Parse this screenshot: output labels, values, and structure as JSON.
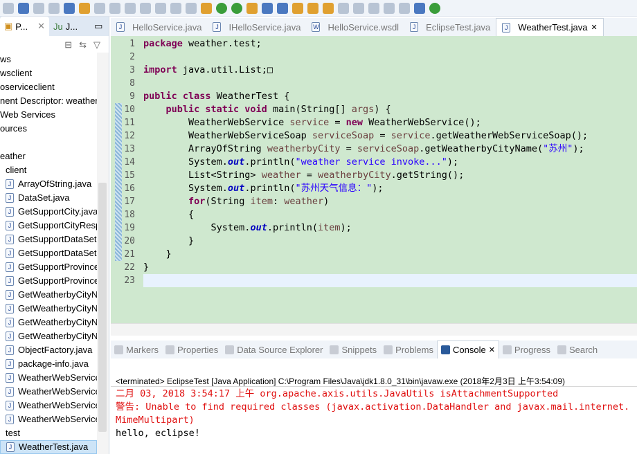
{
  "left_panel": {
    "tabs": [
      {
        "label": "P...",
        "icon": "package-explorer-icon"
      },
      {
        "label": "J...",
        "icon": "junit-icon"
      }
    ],
    "tree": [
      {
        "label": "ws",
        "icon": false,
        "indent": 0
      },
      {
        "label": "wsclient",
        "icon": false,
        "indent": 0
      },
      {
        "label": "oserviceclient",
        "icon": false,
        "indent": 0
      },
      {
        "label": "nent Descriptor: weather",
        "icon": false,
        "indent": 0
      },
      {
        "label": "Web Services",
        "icon": false,
        "indent": 0
      },
      {
        "label": "ources",
        "icon": false,
        "indent": 0
      },
      {
        "label": "",
        "icon": false,
        "indent": 0
      },
      {
        "label": "eather",
        "icon": false,
        "indent": 0
      },
      {
        "label": "client",
        "icon": false,
        "indent": 8
      },
      {
        "label": "ArrayOfString.java",
        "icon": true
      },
      {
        "label": "DataSet.java",
        "icon": true
      },
      {
        "label": "GetSupportCity.java",
        "icon": true
      },
      {
        "label": "GetSupportCityResponse",
        "icon": true
      },
      {
        "label": "GetSupportDataSet",
        "icon": true
      },
      {
        "label": "GetSupportDataSet",
        "icon": true
      },
      {
        "label": "GetSupportProvince",
        "icon": true
      },
      {
        "label": "GetSupportProvince",
        "icon": true
      },
      {
        "label": "GetWeatherbyCityN",
        "icon": true
      },
      {
        "label": "GetWeatherbyCityN",
        "icon": true
      },
      {
        "label": "GetWeatherbyCityN",
        "icon": true
      },
      {
        "label": "GetWeatherbyCityN",
        "icon": true
      },
      {
        "label": "ObjectFactory.java",
        "icon": true
      },
      {
        "label": "package-info.java",
        "icon": true
      },
      {
        "label": "WeatherWebService",
        "icon": true
      },
      {
        "label": "WeatherWebService",
        "icon": true
      },
      {
        "label": "WeatherWebService",
        "icon": true
      },
      {
        "label": "WeatherWebService",
        "icon": true
      },
      {
        "label": "test",
        "icon": false,
        "indent": 8
      },
      {
        "label": "WeatherTest.java",
        "icon": true,
        "selected": true
      }
    ]
  },
  "editor": {
    "tabs": [
      {
        "label": "HelloService.java"
      },
      {
        "label": "IHelloService.java"
      },
      {
        "label": "HelloService.wsdl"
      },
      {
        "label": "EclipseTest.java"
      },
      {
        "label": "WeatherTest.java",
        "active": true
      }
    ],
    "lines": [
      {
        "n": "1",
        "seg": [
          [
            "package",
            "kw"
          ],
          [
            " weather.test;",
            ""
          ]
        ]
      },
      {
        "n": "2",
        "seg": []
      },
      {
        "n": "3",
        "seg": [
          [
            "import",
            "kw"
          ],
          [
            " java.util.List;□",
            ""
          ]
        ]
      },
      {
        "n": "8",
        "seg": []
      },
      {
        "n": "9",
        "seg": [
          [
            "public class",
            "kw"
          ],
          [
            " WeatherTest {",
            ""
          ]
        ]
      },
      {
        "n": "10",
        "seg": [
          [
            "    ",
            ""
          ],
          [
            "public static void",
            "kw"
          ],
          [
            " main(String[] ",
            ""
          ],
          [
            "args",
            "var"
          ],
          [
            ") {",
            ""
          ]
        ]
      },
      {
        "n": "11",
        "seg": [
          [
            "        WeatherWebService ",
            ""
          ],
          [
            "service",
            "var"
          ],
          [
            " = ",
            ""
          ],
          [
            "new",
            "kw"
          ],
          [
            " WeatherWebService();",
            ""
          ]
        ]
      },
      {
        "n": "12",
        "seg": [
          [
            "        WeatherWebServiceSoap ",
            ""
          ],
          [
            "serviceSoap",
            "var"
          ],
          [
            " = ",
            ""
          ],
          [
            "service",
            "var"
          ],
          [
            ".getWeatherWebServiceSoap();",
            ""
          ]
        ]
      },
      {
        "n": "13",
        "seg": [
          [
            "        ArrayOfString ",
            ""
          ],
          [
            "weatherbyCity",
            "var"
          ],
          [
            " = ",
            ""
          ],
          [
            "serviceSoap",
            "var"
          ],
          [
            ".getWeatherbyCityName(",
            ""
          ],
          [
            "\"苏州\"",
            "str"
          ],
          [
            ");",
            ""
          ]
        ]
      },
      {
        "n": "14",
        "seg": [
          [
            "        System.",
            ""
          ],
          [
            "out",
            "fld"
          ],
          [
            ".println(",
            ""
          ],
          [
            "\"weather service invoke...\"",
            "str"
          ],
          [
            ");",
            ""
          ]
        ]
      },
      {
        "n": "15",
        "seg": [
          [
            "        List<String> ",
            ""
          ],
          [
            "weather",
            "var"
          ],
          [
            " = ",
            ""
          ],
          [
            "weatherbyCity",
            "var"
          ],
          [
            ".getString();",
            ""
          ]
        ]
      },
      {
        "n": "16",
        "seg": [
          [
            "        System.",
            ""
          ],
          [
            "out",
            "fld"
          ],
          [
            ".println(",
            ""
          ],
          [
            "\"苏州天气信息：\"",
            "str"
          ],
          [
            ");",
            ""
          ]
        ]
      },
      {
        "n": "17",
        "seg": [
          [
            "        ",
            ""
          ],
          [
            "for",
            "kw"
          ],
          [
            "(String ",
            ""
          ],
          [
            "item",
            "var"
          ],
          [
            ": ",
            ""
          ],
          [
            "weather",
            "var"
          ],
          [
            ")",
            ""
          ]
        ]
      },
      {
        "n": "18",
        "seg": [
          [
            "        {",
            ""
          ]
        ]
      },
      {
        "n": "19",
        "seg": [
          [
            "            System.",
            ""
          ],
          [
            "out",
            "fld"
          ],
          [
            ".println(",
            ""
          ],
          [
            "item",
            "var"
          ],
          [
            ");",
            ""
          ]
        ]
      },
      {
        "n": "20",
        "seg": [
          [
            "        }",
            ""
          ]
        ]
      },
      {
        "n": "21",
        "seg": [
          [
            "    }",
            ""
          ]
        ]
      },
      {
        "n": "22",
        "seg": [
          [
            "}",
            ""
          ]
        ]
      },
      {
        "n": "23",
        "seg": [],
        "current": true
      }
    ]
  },
  "bottom_panel": {
    "tabs": [
      {
        "label": "Markers"
      },
      {
        "label": "Properties"
      },
      {
        "label": "Data Source Explorer"
      },
      {
        "label": "Snippets"
      },
      {
        "label": "Problems"
      },
      {
        "label": "Console",
        "active": true
      },
      {
        "label": "Progress"
      },
      {
        "label": "Search"
      }
    ]
  },
  "console": {
    "status": "<terminated> EclipseTest [Java Application] C:\\Program Files\\Java\\jdk1.8.0_31\\bin\\javaw.exe (2018年2月3日 上午3:54:09)",
    "output": [
      {
        "text": "二月 03, 2018 3:54:17 上午 org.apache.axis.utils.JavaUtils isAttachmentSupported",
        "error": true
      },
      {
        "text": "警告: Unable to find required classes (javax.activation.DataHandler and javax.mail.internet.MimeMultipart)",
        "error": true
      },
      {
        "text": "hello, eclipse!",
        "error": false
      }
    ]
  },
  "colors": {
    "editor_bg": "#cfe8cf",
    "keyword": "#7f0055",
    "string": "#2a00ff",
    "error": "#e01010"
  }
}
